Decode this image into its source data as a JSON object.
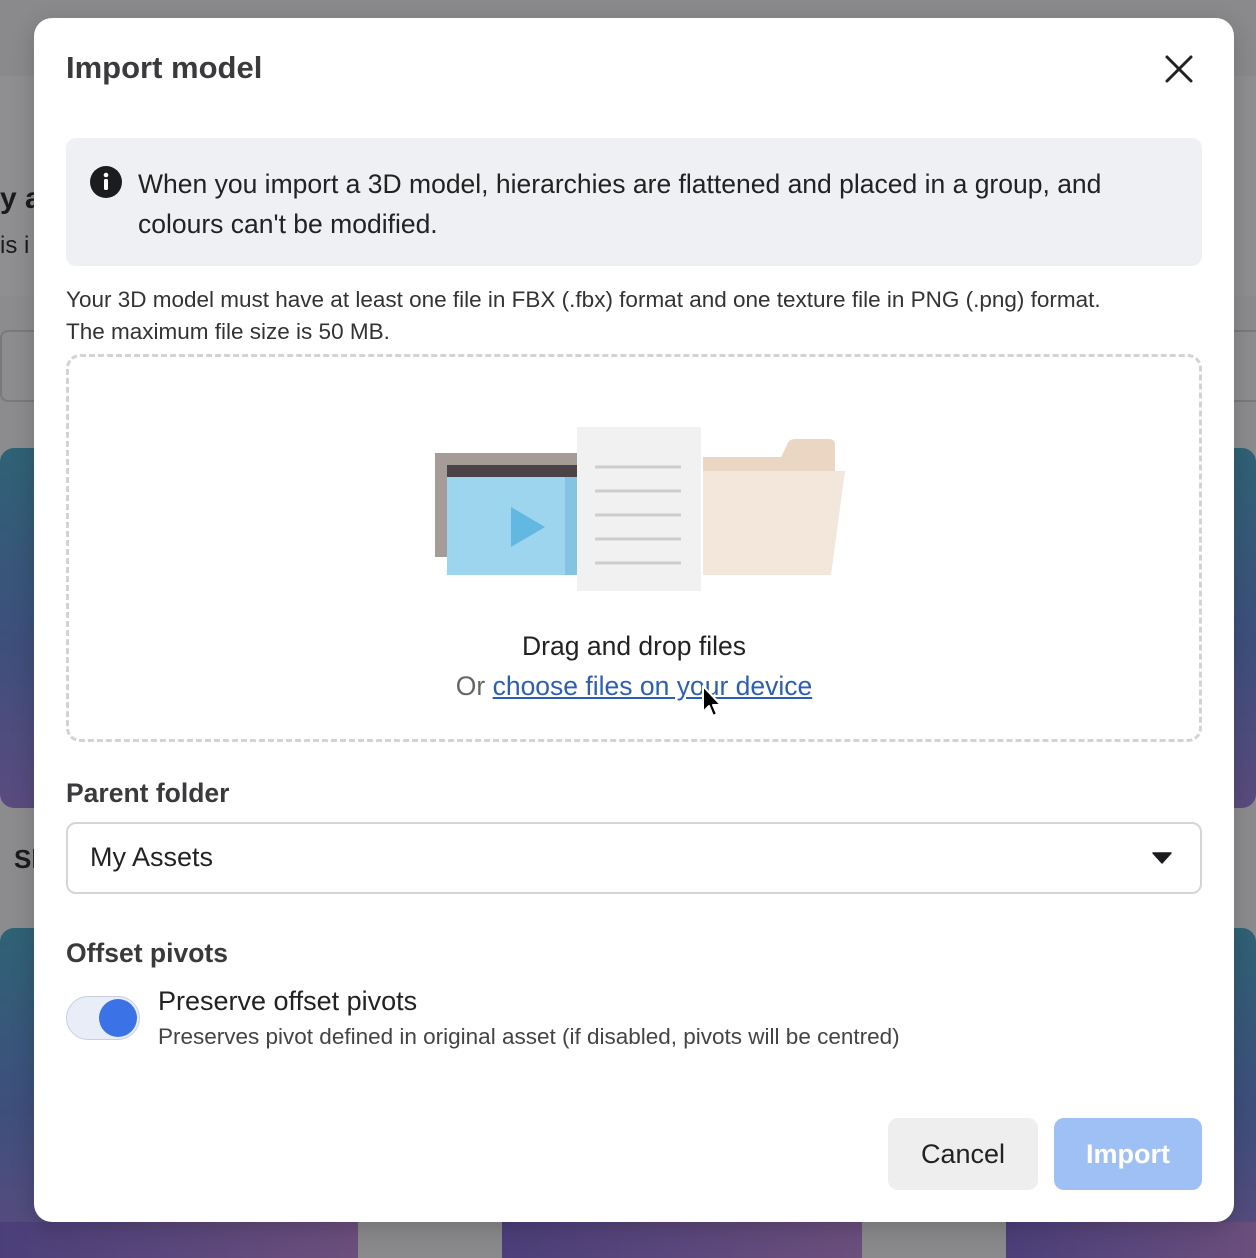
{
  "dialog": {
    "title": "Import model",
    "close_icon": "close-icon"
  },
  "info_banner": {
    "icon": "info-icon",
    "text": "When you import a 3D model, hierarchies are flattened and placed in a group, and colours can't be modified."
  },
  "requirements": {
    "line1": "Your 3D model must have at least one file in FBX (.fbx) format and one texture file in PNG (.png) format.",
    "line2": "The maximum file size is 50 MB."
  },
  "dropzone": {
    "drag_text": "Drag and drop files",
    "or_text": "Or",
    "choose_link": "choose files on your device"
  },
  "parent_folder": {
    "label": "Parent folder",
    "selected": "My Assets"
  },
  "offset_pivots": {
    "label": "Offset pivots",
    "toggle_on": true,
    "option_title": "Preserve offset pivots",
    "option_description": "Preserves pivot defined in original asset (if disabled, pivots will be centred)"
  },
  "footer": {
    "cancel_label": "Cancel",
    "import_label": "Import"
  },
  "background": {
    "partial_text_1": "y a",
    "partial_text_2": "is i",
    "partial_text_3": "Sl"
  },
  "colors": {
    "accent": "#3b72e6",
    "link": "#2c5fb4",
    "import_disabled": "#9ec0f4"
  }
}
